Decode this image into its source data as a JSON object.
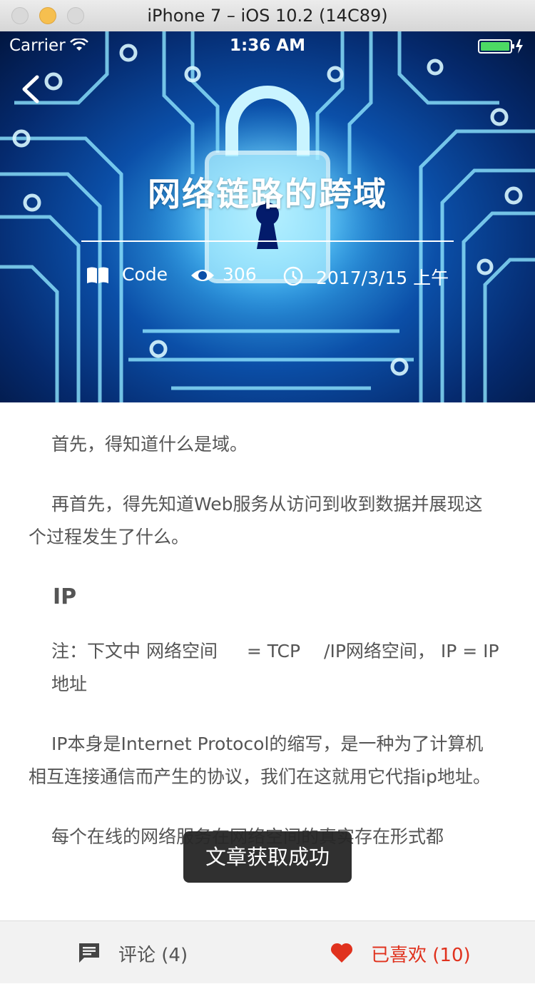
{
  "window": {
    "title": "iPhone 7 – iOS 10.2 (14C89)"
  },
  "status_bar": {
    "carrier": "Carrier",
    "time": "1:36 AM"
  },
  "article": {
    "title": "网络链路的跨域",
    "category": "Code",
    "views": "306",
    "date": "2017/3/15 上午",
    "paragraphs": {
      "p1": "首先，得知道什么是域。",
      "p2": "再首先，得先知道Web服务从访问到收到数据并展现这个过程发生了什么。",
      "heading_ip": "IP",
      "note": "注：下文中 网络空间 　 = TCP 　/IP网络空间， IP = IP地址",
      "p3": "IP本身是Internet Protocol的缩写，是一种为了计算机相互连接通信而产生的协议，我们在这就用它代指ip地址。",
      "p4": "每个在线的网络服务在网络空间的真实存在形式都"
    }
  },
  "toast": {
    "text": "文章获取成功"
  },
  "bottom_bar": {
    "comment_label": "评论 (4)",
    "like_label": "已喜欢 (10)"
  },
  "colors": {
    "like_accent": "#e0321e",
    "text": "#555555",
    "bar_background": "#f2f2f2",
    "battery": "#4cd964"
  }
}
